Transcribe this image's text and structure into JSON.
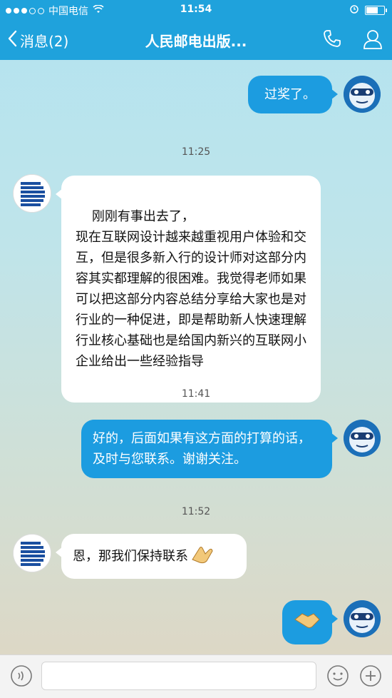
{
  "status": {
    "carrier": "中国电信",
    "time": "11:54"
  },
  "nav": {
    "back_label": "消息(2)",
    "title": "人民邮电出版...",
    "phone_icon": "phone-icon",
    "profile_icon": "user-icon"
  },
  "messages": [
    {
      "text": "过奖了。"
    },
    {
      "timestamp": "11:25"
    },
    {
      "text": "刚刚有事出去了，\n现在互联网设计越来越重视用户体验和交互，但是很多新入行的设计师对这部分内容其实都理解的很困难。我觉得老师如果可以把这部分内容总结分享给大家也是对行业的一种促进，即是帮助新人快速理解行业核心基础也是给国内新兴的互联网小企业给出一些经验指导"
    },
    {
      "timestamp": "11:41"
    },
    {
      "text": "好的，后面如果有这方面的打算的话，及时与您联系。谢谢关注。"
    },
    {
      "timestamp": "11:52"
    },
    {
      "text": "恩，那我们保持联系",
      "emoji": "hand-clap-emoji"
    },
    {
      "emoji": "handshake-emoji"
    }
  ],
  "input": {
    "placeholder": "",
    "voice_icon": "voice-icon",
    "emoji_icon": "smiley-icon",
    "plus_icon": "plus-icon"
  }
}
